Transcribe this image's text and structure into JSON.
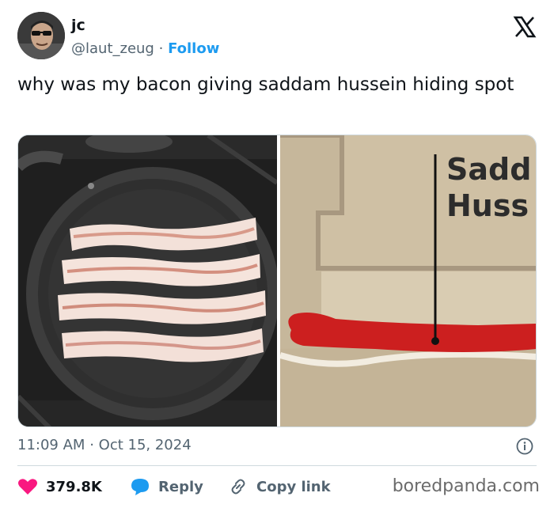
{
  "user": {
    "display_name": "jc",
    "handle": "@laut_zeug",
    "separator": "·",
    "follow_label": "Follow"
  },
  "tweet": {
    "text": "why was my bacon giving saddam hussein hiding spot"
  },
  "media": {
    "left_image": "frying pan with four bacon strips on a stove",
    "right_image": "diagram of red figure lying in underground hole",
    "diagram_label_line1": "Sadd",
    "diagram_label_line2": "Huss"
  },
  "meta": {
    "time": "11:09 AM",
    "dot": "·",
    "date": "Oct 15, 2024"
  },
  "actions": {
    "likes": "379.8K",
    "reply_label": "Reply",
    "copy_label": "Copy link"
  },
  "watermark": "boredpanda.com",
  "colors": {
    "accent": "#1d9bf0",
    "like": "#f91880",
    "text": "#0f1419",
    "muted": "#536471"
  }
}
